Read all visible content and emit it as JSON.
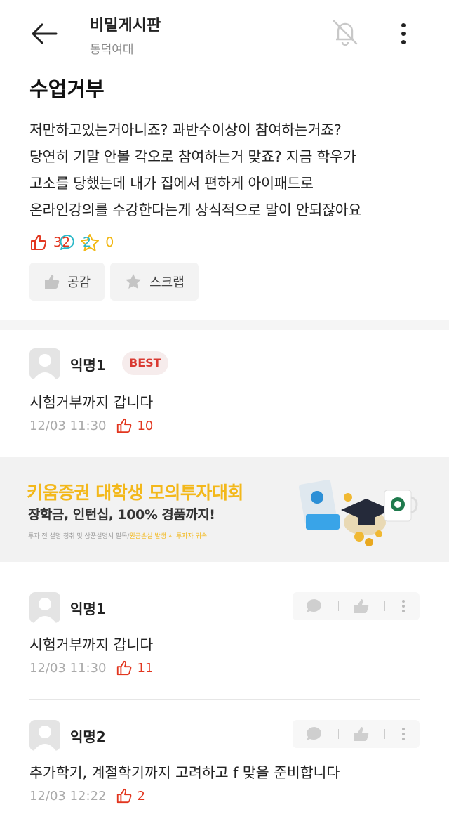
{
  "header": {
    "board_title": "비밀게시판",
    "school": "동덕여대"
  },
  "post": {
    "title": "수업거부",
    "body": "저만하고있는거아니죠? 과반수이상이 참여하는거죠?\n당연히 기말 안볼 각오로 참여하는거 맞죠? 지금 학우가\n고소를 당했는데 내가 집에서 편하게 아이패드로\n온라인강의를 수강한다는게 상식적으로 말이 안되잖아요",
    "likes": "32",
    "comments": "2",
    "scraps": "0",
    "like_button": "공감",
    "scrap_button": "스크랩"
  },
  "best_comment": {
    "name": "익명1",
    "badge": "BEST",
    "text": "시험거부까지 갑니다",
    "time": "12/03 11:30",
    "likes": "10"
  },
  "ad": {
    "headline": "키움증권 대학생 모의투자대회",
    "subline": "장학금, 인턴십, 100% 경품까지!",
    "disclaimer": "투자 전 설명 청취 및 상품설명서 필독/",
    "disclaimer_highlight": "원금손실 발생 시 투자자 귀속"
  },
  "comments": [
    {
      "name": "익명1",
      "text": "시험거부까지 갑니다",
      "time": "12/03 11:30",
      "likes": "11"
    },
    {
      "name": "익명2",
      "text": "추가학기, 계절학기까지 고려하고 f 맞을 준비합니다",
      "time": "12/03 12:22",
      "likes": "2"
    }
  ],
  "colors": {
    "like": "#e2361f",
    "comment": "#2bb8c8",
    "scrap": "#f2b712",
    "ad_yellow": "#f3b81b"
  }
}
